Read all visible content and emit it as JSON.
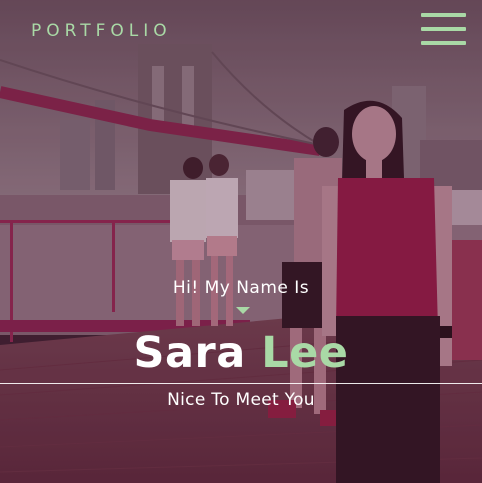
{
  "header": {
    "brand": "PORTFOLIO",
    "menu_icon": "hamburger-menu-icon"
  },
  "hero": {
    "greeting": "Hi! My Name Is",
    "first_name": "Sara",
    "last_name": "Lee",
    "tagline": "Nice To Meet You",
    "caret_icon": "caret-down-icon"
  },
  "colors": {
    "accent": "#a9d9a6",
    "text": "#ffffff",
    "overlay_tint": "#8a2d5a"
  }
}
